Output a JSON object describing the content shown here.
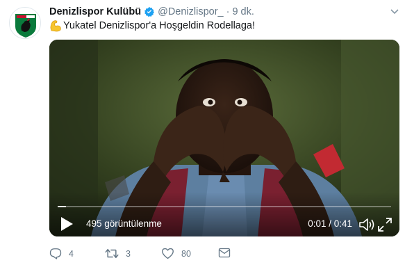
{
  "account": {
    "name": "Denizlispor Kulübü",
    "handle": "@Denizlispor_",
    "separator": "·",
    "time": "9 dk.",
    "avatar_icon": "denizlispor-rooster-crest",
    "verified_icon": "verified-badge"
  },
  "tweet": {
    "emoji": "flexed-biceps",
    "text": "Yukatel Denizlispor'a Hoşgeldin Rodellaga!"
  },
  "video": {
    "views": "495 görüntülenme",
    "time": "0:01 / 0:41",
    "progress": 0.024,
    "icons": [
      "play-icon",
      "volume-icon",
      "fullscreen-icon"
    ]
  },
  "actions": {
    "replies": "4",
    "retweets": "3",
    "likes": "80"
  },
  "colors": {
    "text": "#14171a",
    "muted": "#657786",
    "verified": "#1da1f2",
    "brand_green": "#0a7a3c"
  }
}
